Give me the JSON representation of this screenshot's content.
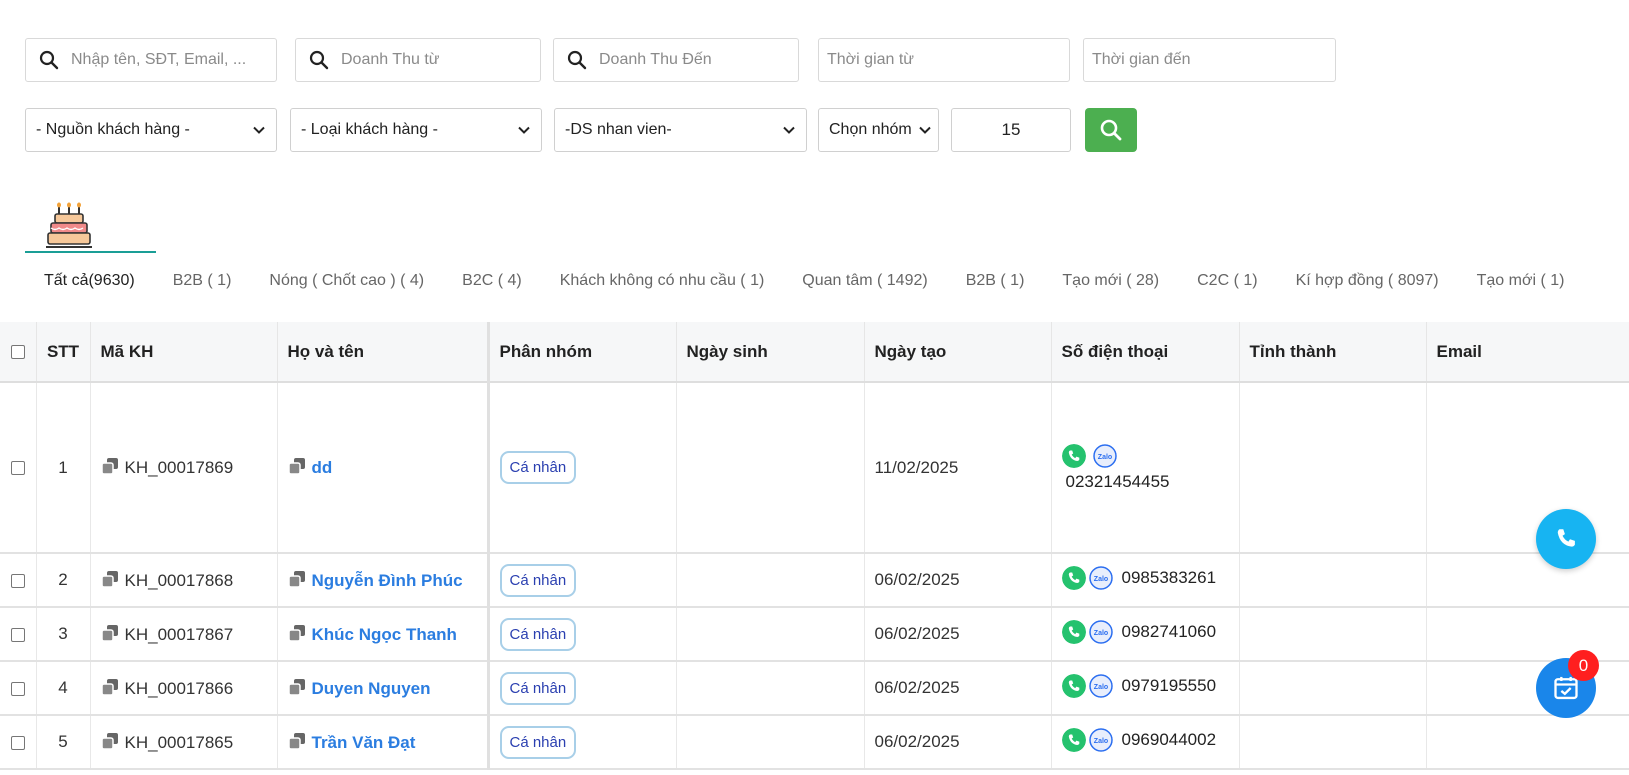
{
  "filters": {
    "search_placeholder": "Nhập tên, SĐT, Email, ...",
    "revenue_from_placeholder": "Doanh Thu từ",
    "revenue_to_placeholder": "Doanh Thu Đến",
    "time_from_placeholder": "Thời gian từ",
    "time_to_placeholder": "Thời gian đến",
    "source_select": "- Nguồn khách hàng -",
    "type_select": "- Loại khách hàng -",
    "staff_select": "-DS nhan vien-",
    "group_select": "Chọn nhóm",
    "page_size": "15"
  },
  "tabs": [
    {
      "label": "Tất cả(9630)",
      "active": true
    },
    {
      "label": "B2B ( 1)"
    },
    {
      "label": "Nóng ( Chốt cao ) ( 4)"
    },
    {
      "label": "B2C ( 4)"
    },
    {
      "label": "Khách không có nhu cầu ( 1)"
    },
    {
      "label": "Quan tâm ( 1492)"
    },
    {
      "label": "B2B ( 1)"
    },
    {
      "label": "Tạo mới ( 28)"
    },
    {
      "label": "C2C ( 1)"
    },
    {
      "label": "Kí hợp đồng ( 8097)"
    },
    {
      "label": "Tạo mới ( 1)"
    }
  ],
  "table": {
    "headers": {
      "stt": "STT",
      "code": "Mã KH",
      "name": "Họ và tên",
      "group": "Phân nhóm",
      "birthday": "Ngày sinh",
      "created": "Ngày tạo",
      "phone": "Số điện thoại",
      "province": "Tỉnh thành",
      "email": "Email"
    },
    "rows": [
      {
        "stt": "1",
        "code": "KH_00017869",
        "name": "dd",
        "group": "Cá nhân",
        "birthday": "",
        "created": "11/02/2025",
        "phone": "02321454455",
        "province": "",
        "email": ""
      },
      {
        "stt": "2",
        "code": "KH_00017868",
        "name": "Nguyễn Đình Phúc",
        "group": "Cá nhân",
        "birthday": "",
        "created": "06/02/2025",
        "phone": "0985383261",
        "province": "",
        "email": ""
      },
      {
        "stt": "3",
        "code": "KH_00017867",
        "name": "Khúc Ngọc Thanh",
        "group": "Cá nhân",
        "birthday": "",
        "created": "06/02/2025",
        "phone": "0982741060",
        "province": "",
        "email": ""
      },
      {
        "stt": "4",
        "code": "KH_00017866",
        "name": "Duyen Nguyen",
        "group": "Cá nhân",
        "birthday": "",
        "created": "06/02/2025",
        "phone": "0979195550",
        "province": "",
        "email": ""
      },
      {
        "stt": "5",
        "code": "KH_00017865",
        "name": "Trần Văn Đạt",
        "group": "Cá nhân",
        "birthday": "",
        "created": "06/02/2025",
        "phone": "0969044002",
        "province": "",
        "email": ""
      }
    ]
  },
  "task_count": "0",
  "colors": {
    "accent_green": "#4caf50",
    "link_blue": "#2b7de0",
    "fab_call": "#17b4f2",
    "fab_task": "#1a86ea",
    "badge_red": "#ff1f1f",
    "tab_underline": "#1a9e96"
  },
  "icons": {
    "search": "search-icon",
    "chevron": "chevron-down-icon",
    "cake": "birthday-cake-icon",
    "copy": "copy-icon",
    "call": "phone-call-icon",
    "zalo": "zalo-icon",
    "task": "calendar-check-icon"
  }
}
